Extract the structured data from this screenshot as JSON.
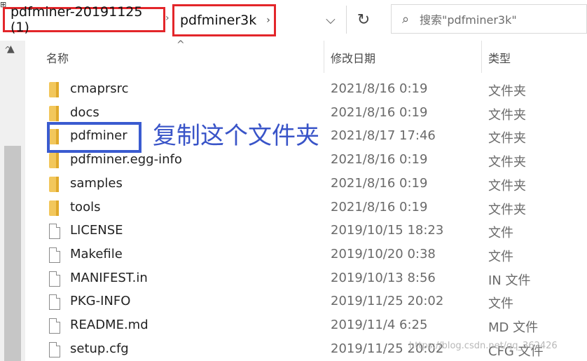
{
  "breadcrumb": {
    "parent": "pdfminer-20191125 (1)",
    "current": "pdfminer3k"
  },
  "search": {
    "placeholder": "搜索\"pdfminer3k\""
  },
  "columns": {
    "name": "名称",
    "date": "修改日期",
    "type": "类型"
  },
  "rows": [
    {
      "name": "cmaprsrc",
      "date": "2021/8/16 0:19",
      "type": "文件夹",
      "icon": "folder-icon"
    },
    {
      "name": "docs",
      "date": "2021/8/16 0:19",
      "type": "文件夹",
      "icon": "folder-icon"
    },
    {
      "name": "pdfminer",
      "date": "2021/8/17 17:46",
      "type": "文件夹",
      "icon": "folder-icon"
    },
    {
      "name": "pdfminer.egg-info",
      "date": "2021/8/16 0:19",
      "type": "文件夹",
      "icon": "folder-icon"
    },
    {
      "name": "samples",
      "date": "2021/8/16 0:19",
      "type": "文件夹",
      "icon": "folder-icon"
    },
    {
      "name": "tools",
      "date": "2021/8/16 0:19",
      "type": "文件夹",
      "icon": "folder-icon"
    },
    {
      "name": "LICENSE",
      "date": "2019/10/15 18:23",
      "type": "文件",
      "icon": "file-icon"
    },
    {
      "name": "Makefile",
      "date": "2019/10/20 0:38",
      "type": "文件",
      "icon": "file-icon"
    },
    {
      "name": "MANIFEST.in",
      "date": "2019/10/13 8:56",
      "type": "IN 文件",
      "icon": "file-icon"
    },
    {
      "name": "PKG-INFO",
      "date": "2019/11/25 20:02",
      "type": "文件",
      "icon": "file-icon"
    },
    {
      "name": "README.md",
      "date": "2019/11/4 6:25",
      "type": "MD 文件",
      "icon": "file-icon"
    },
    {
      "name": "setup.cfg",
      "date": "2019/11/25 20:02",
      "type": "CFG 文件",
      "icon": "file-icon"
    }
  ],
  "annotation": "复制这个文件夹",
  "watermark": "https://blog.csdn.net/qq_362426"
}
